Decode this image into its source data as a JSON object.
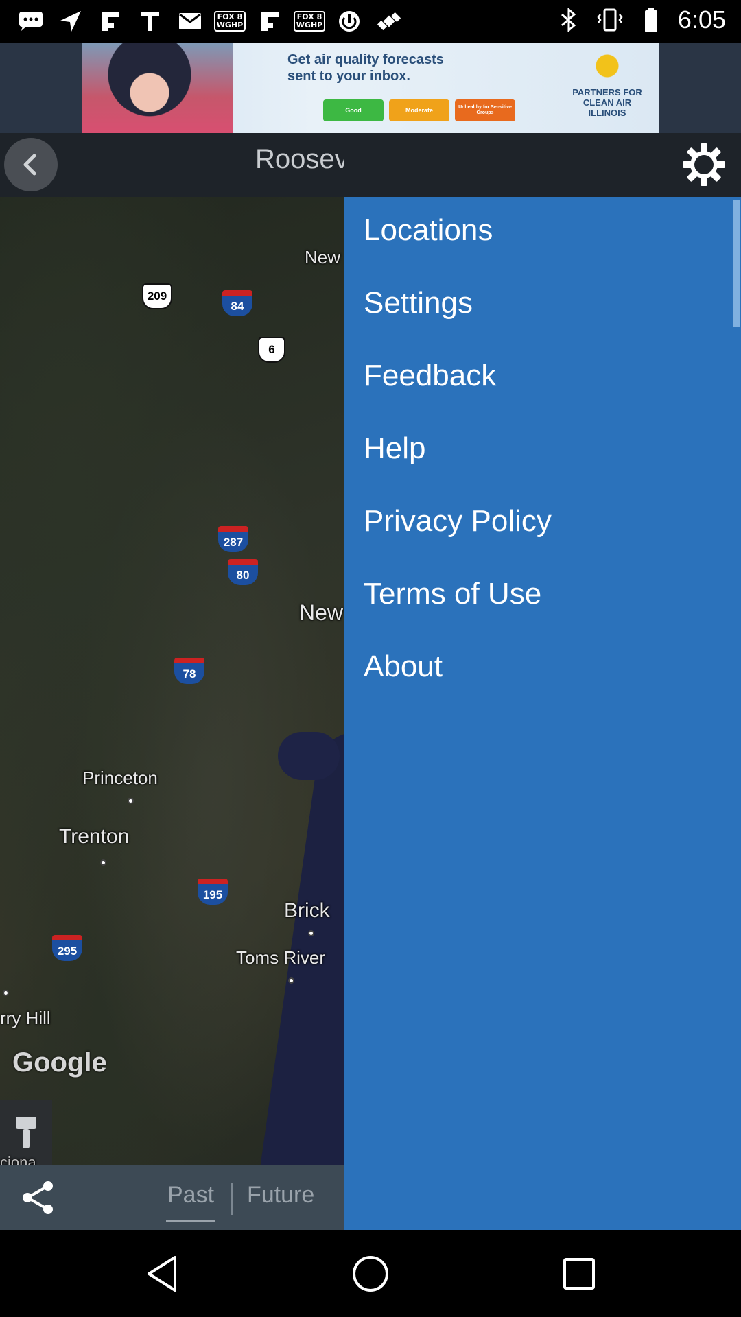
{
  "status_bar": {
    "time": "6:05",
    "left_icons": [
      "chat-icon",
      "navigation-icon",
      "flipboard-icon",
      "font-icon",
      "mail-icon",
      "fox8-icon",
      "flipboard-icon",
      "fox8-icon",
      "power-icon",
      "satellite-icon"
    ],
    "fox_tag_line1": "FOX 8",
    "fox_tag_line2": "WGHP",
    "right_icons": [
      "bluetooth-icon",
      "vibrate-icon",
      "battery-icon"
    ]
  },
  "ad": {
    "headline": "Get air quality forecasts sent to your inbox.",
    "buttons": [
      {
        "label": "Good",
        "color": "#3db843"
      },
      {
        "label": "Moderate",
        "color": "#f0a21a"
      },
      {
        "label": "Unhealthy for Sensitive Groups",
        "color": "#e86a1e"
      }
    ],
    "logo_text": "PARTNERS FOR CLEAN AIR ILLINOIS"
  },
  "header": {
    "title": "Roosev"
  },
  "map": {
    "labels": [
      {
        "text": "New",
        "name": "map-label-new-north"
      },
      {
        "text": "New",
        "name": "map-label-new-south"
      },
      {
        "text": "Princeton",
        "name": "map-label-princeton"
      },
      {
        "text": "Trenton",
        "name": "map-label-trenton"
      },
      {
        "text": "Brick",
        "name": "map-label-brick"
      },
      {
        "text": "Toms River",
        "name": "map-label-toms-river"
      },
      {
        "text": "rry Hill",
        "name": "map-label-cherry-hill"
      }
    ],
    "shields": [
      {
        "text": "209",
        "kind": "us"
      },
      {
        "text": "84",
        "kind": "interstate"
      },
      {
        "text": "6",
        "kind": "us"
      },
      {
        "text": "287",
        "kind": "interstate"
      },
      {
        "text": "80",
        "kind": "interstate"
      },
      {
        "text": "78",
        "kind": "interstate"
      },
      {
        "text": "195",
        "kind": "interstate"
      },
      {
        "text": "295",
        "kind": "interstate"
      }
    ],
    "attribution": "Google",
    "bottom_edge_label": "ciona"
  },
  "bottom_bar": {
    "tabs": [
      {
        "label": "Past",
        "active": true
      },
      {
        "label": "Future",
        "active": false
      }
    ]
  },
  "drawer": {
    "items": [
      {
        "label": "Locations"
      },
      {
        "label": "Settings"
      },
      {
        "label": "Feedback"
      },
      {
        "label": "Help"
      },
      {
        "label": "Privacy Policy"
      },
      {
        "label": "Terms of Use"
      },
      {
        "label": "About"
      }
    ]
  },
  "nav_bar": {
    "buttons": [
      "back-icon",
      "home-icon",
      "recents-icon"
    ]
  }
}
